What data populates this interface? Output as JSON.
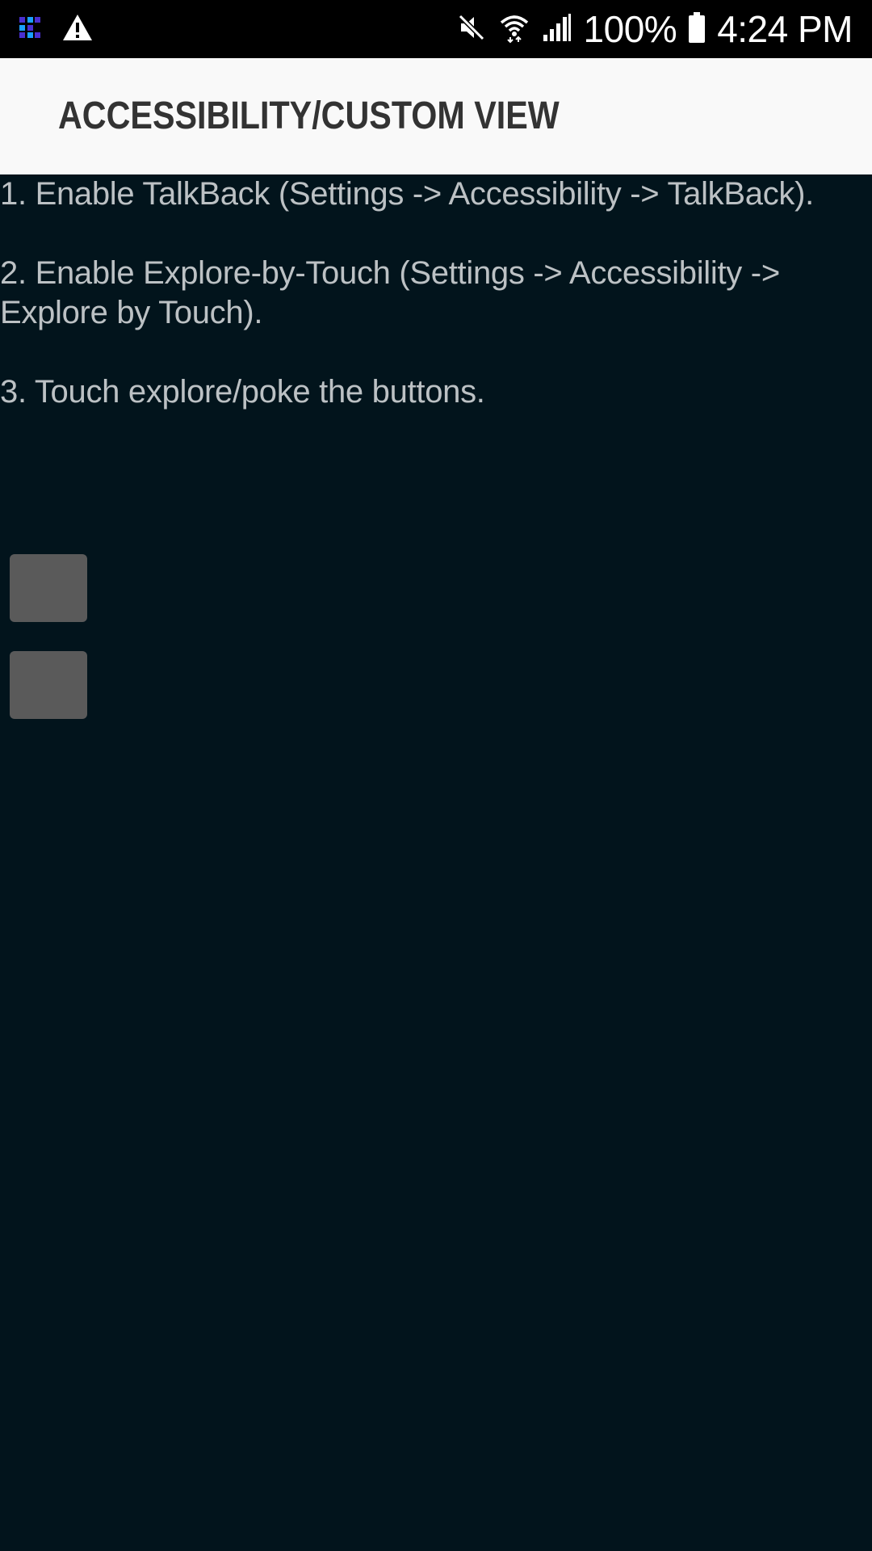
{
  "status_bar": {
    "battery_percent": "100%",
    "time": "4:24 PM",
    "icons": {
      "left": [
        "app-notification-icon",
        "warning-icon"
      ],
      "right": [
        "mute-icon",
        "wifi-icon",
        "signal-icon",
        "battery-icon"
      ]
    }
  },
  "app_bar": {
    "title": "ACCESSIBILITY/CUSTOM VIEW"
  },
  "instructions": {
    "step1": "1. Enable TalkBack (Settings -> Accessibility -> TalkBack).",
    "step2": "2. Enable Explore-by-Touch (Settings -> Accessibility -> Explore by Touch).",
    "step3": "3. Touch explore/poke the buttons."
  },
  "buttons": {
    "count": 2
  },
  "colors": {
    "status_bar_bg": "#000000",
    "app_bar_bg": "#f9f9f9",
    "title_text": "#333333",
    "content_bg": "#02141c",
    "body_text": "#bcc1c4",
    "button_fill": "#5a5a5a"
  }
}
